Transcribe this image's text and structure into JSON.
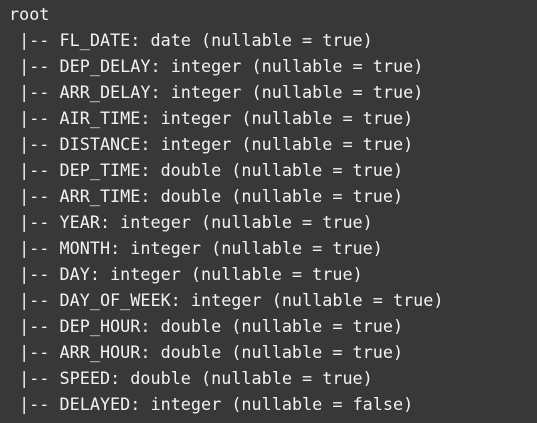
{
  "schema": {
    "root_label": "root",
    "branch_prefix": " |-- ",
    "fields": [
      {
        "name": "FL_DATE",
        "type": "date",
        "nullable": "true"
      },
      {
        "name": "DEP_DELAY",
        "type": "integer",
        "nullable": "true"
      },
      {
        "name": "ARR_DELAY",
        "type": "integer",
        "nullable": "true"
      },
      {
        "name": "AIR_TIME",
        "type": "integer",
        "nullable": "true"
      },
      {
        "name": "DISTANCE",
        "type": "integer",
        "nullable": "true"
      },
      {
        "name": "DEP_TIME",
        "type": "double",
        "nullable": "true"
      },
      {
        "name": "ARR_TIME",
        "type": "double",
        "nullable": "true"
      },
      {
        "name": "YEAR",
        "type": "integer",
        "nullable": "true"
      },
      {
        "name": "MONTH",
        "type": "integer",
        "nullable": "true"
      },
      {
        "name": "DAY",
        "type": "integer",
        "nullable": "true"
      },
      {
        "name": "DAY_OF_WEEK",
        "type": "integer",
        "nullable": "true"
      },
      {
        "name": "DEP_HOUR",
        "type": "double",
        "nullable": "true"
      },
      {
        "name": "ARR_HOUR",
        "type": "double",
        "nullable": "true"
      },
      {
        "name": "SPEED",
        "type": "double",
        "nullable": "true"
      },
      {
        "name": "DELAYED",
        "type": "integer",
        "nullable": "false"
      }
    ]
  },
  "colors": {
    "background": "#383838",
    "text": "#f2f2f2"
  }
}
